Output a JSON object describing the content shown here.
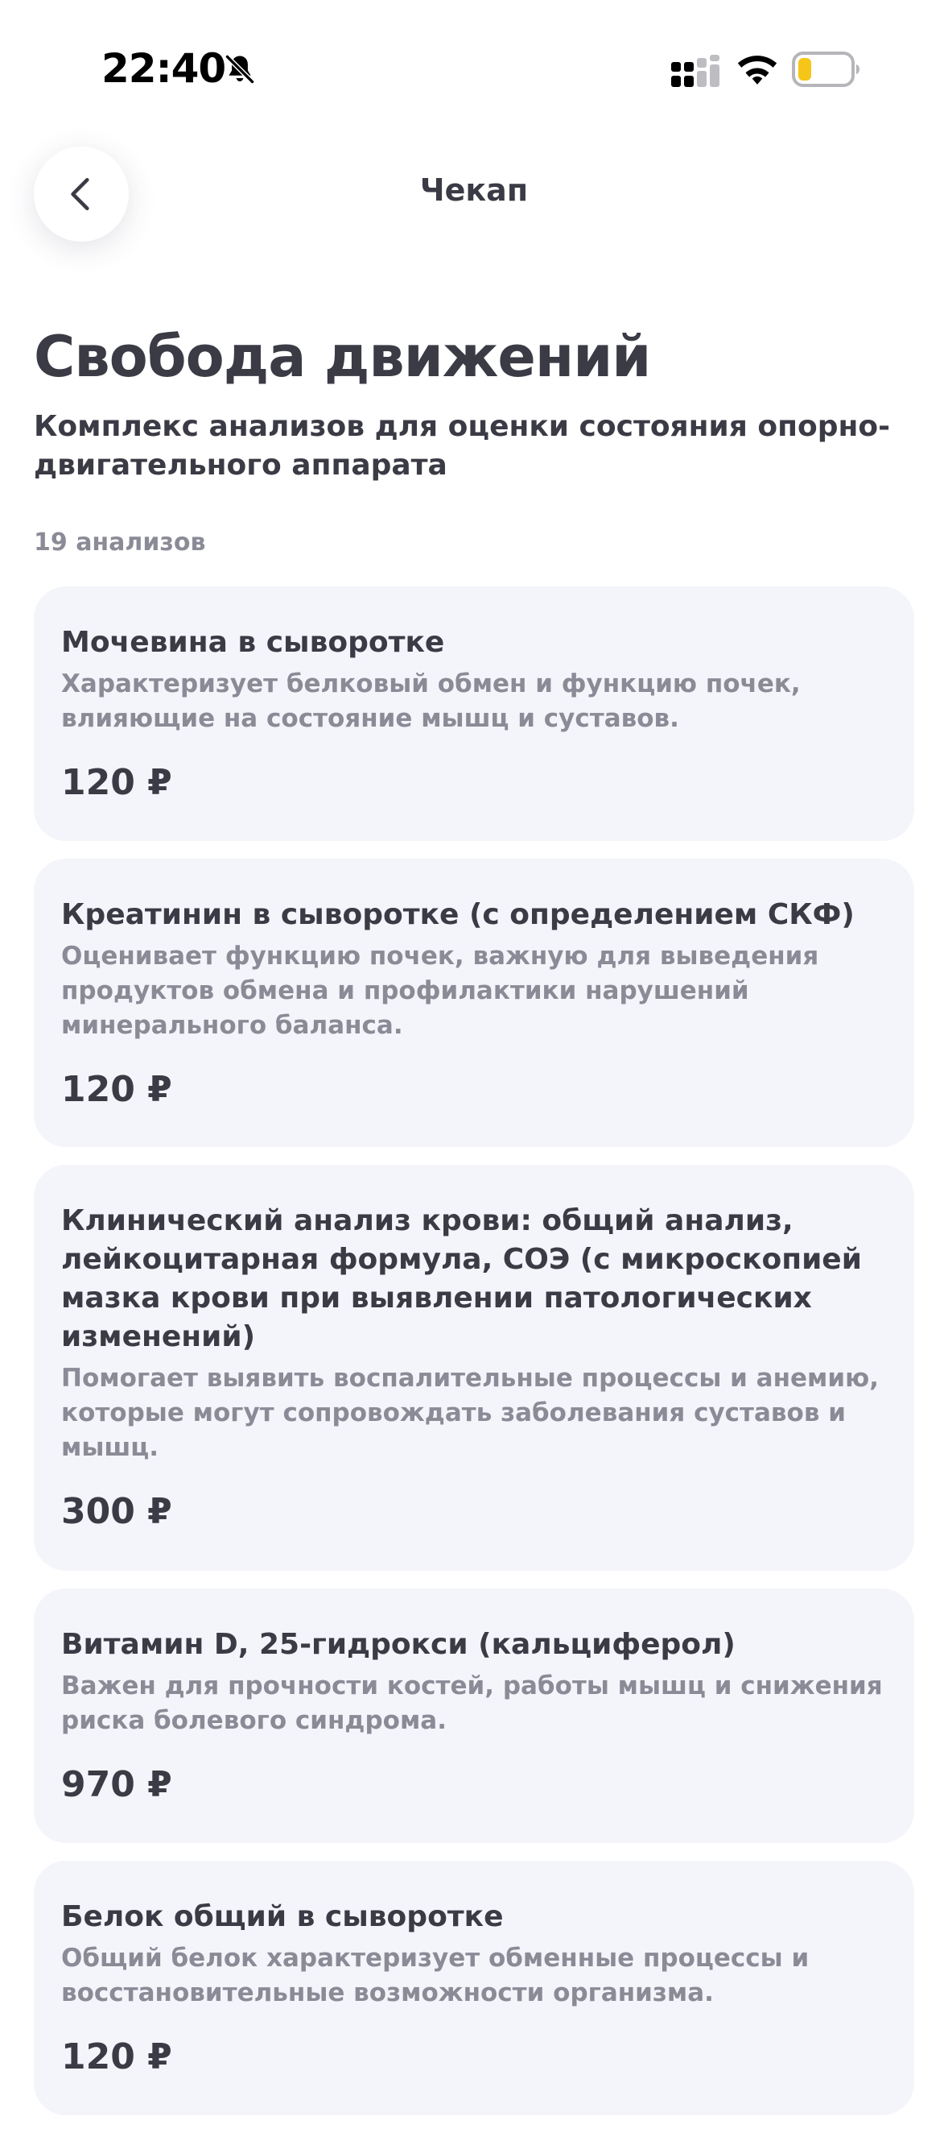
{
  "status_bar": {
    "time": "22:40",
    "icons": [
      "bell-muted-icon",
      "signal-icon",
      "wifi-icon",
      "battery-icon"
    ],
    "battery_color": "#f5c517"
  },
  "header": {
    "back_icon": "chevron-left-icon",
    "title": "Чекап"
  },
  "intro": {
    "title": "Свобода движений",
    "subtitle": "Комплекс анализов для оценки состояния опорно-двигательного аппарата",
    "count": "19 анализов"
  },
  "colors": {
    "text_primary": "#3b3b46",
    "text_secondary": "#8b8b97",
    "card_background": "#f4f5fa"
  },
  "tests": [
    {
      "title": "Мочевина в сыворотке",
      "description": "Характеризует белковый обмен и функцию почек, влияющие на состояние мышц и суставов.",
      "price": "120 ₽"
    },
    {
      "title": "Креатинин в сыворотке (с определением СКФ)",
      "description": "Оценивает функцию почек, важную для выведения продуктов обмена и профилактики нарушений минерального баланса.",
      "price": "120 ₽"
    },
    {
      "title": "Клинический анализ крови: общий анализ, лейкоцитарная формула, СОЭ (с микроскопией мазка крови при выявлении патологических изменений)",
      "description": "Помогает выявить воспалительные процессы и анемию, которые могут сопровождать заболевания суставов и мышц.",
      "price": "300 ₽"
    },
    {
      "title": "Витамин D, 25-гидрокси (кальциферол)",
      "description": "Важен для прочности костей, работы мышц и снижения риска болевого синдрома.",
      "price": "970 ₽"
    },
    {
      "title": "Белок общий в сыворотке",
      "description": "Общий белок характеризует обменные процессы и восстановительные возможности организма.",
      "price": "120 ₽"
    }
  ]
}
